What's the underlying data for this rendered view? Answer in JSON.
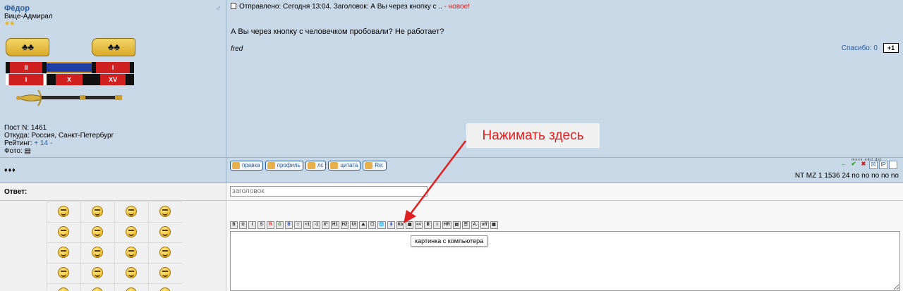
{
  "post": {
    "author": "Фёдор",
    "rank": "Вице-Адмирал",
    "stars": "★★",
    "ribbon_labels": [
      "II",
      "",
      "I",
      "I",
      "X",
      "XV"
    ],
    "meta": {
      "posts": "Пост N: 1461",
      "location": "Откуда: Россия, Санкт-Петербург",
      "rating_label": "Рейтинг:",
      "rating_value": "+ 14",
      "rating_minus": "-",
      "photo_label": "Фото:"
    },
    "header_text": "Отправлено: Сегодня 13:04. Заголовок: А Вы через кнопку с ..",
    "header_new": "- новое!",
    "body": "А Вы через кнопку с человечком пробовали? Не работает?",
    "signature": "fred",
    "thanks_label": "Спасибо: 0",
    "plus_one": "+1"
  },
  "action_bar": {
    "dots": "♦♦♦",
    "buttons": [
      "правка",
      "профиль",
      "лс",
      "цитата",
      "Re:"
    ],
    "tools_caption": "move  edit  del",
    "mod_tools": [
      "←",
      "✔",
      "✖",
      "☒",
      "IP",
      ""
    ],
    "nt_line": "NT MZ 1 1536 24 no no no no no"
  },
  "reply": {
    "label": "Ответ:",
    "title_placeholder": "заголовок",
    "toolbar": [
      "B",
      "U",
      "I",
      "S",
      "R",
      "G",
      "B",
      "☺",
      "+1",
      "-1",
      "X²",
      "H1",
      "H2",
      "Ut",
      "⛰",
      "☐",
      "🌐",
      "⬇",
      "Кb",
      "▦",
      "<<",
      "Ⅲ",
      "≡",
      "HR",
      "▤",
      "☰",
      "A.",
      "off",
      "▦"
    ],
    "tooltip": "картинка с компьютера"
  },
  "annotation": {
    "callout": "Нажимать здесь",
    "color": "#e02020"
  }
}
